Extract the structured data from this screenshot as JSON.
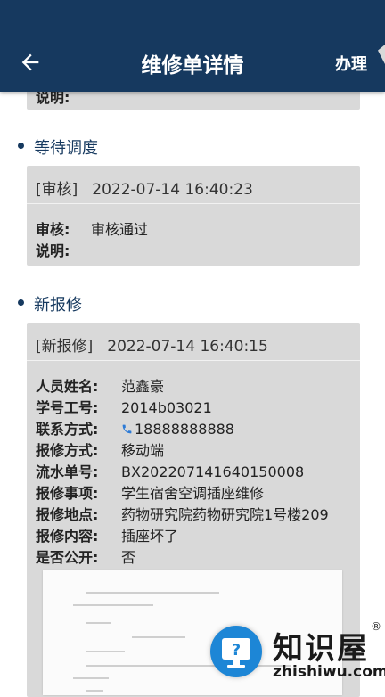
{
  "header": {
    "title": "维修单详情",
    "action_label": "办理"
  },
  "top_card": {
    "partial_label": "说明:"
  },
  "sections": [
    {
      "title": "等待调度",
      "tag": "[审核]",
      "time": "2022-07-14 16:40:23",
      "review_key": "审核:",
      "review_value": "审核通过",
      "note_key": "说明:"
    },
    {
      "title": "新报修",
      "tag": "[新报修]",
      "time": "2022-07-14 16:40:15",
      "fields": [
        {
          "k": "人员姓名:",
          "v": "范鑫豪"
        },
        {
          "k": "学号工号:",
          "v": "2014b03021"
        },
        {
          "k": "联系方式:",
          "v": "18888888888"
        },
        {
          "k": "报修方式:",
          "v": "移动端"
        },
        {
          "k": "流水单号:",
          "v": "BX202207141640150008"
        },
        {
          "k": "报修事项:",
          "v": "学生宿舍空调插座维修"
        },
        {
          "k": "报修地点:",
          "v": "药物研究院药物研究院1号楼209"
        },
        {
          "k": "报修内容:",
          "v": "插座坏了"
        },
        {
          "k": "是否公开:",
          "v": "否"
        }
      ]
    }
  ],
  "watermark": {
    "brand": "知识屋",
    "reg": "®",
    "url": "zhishiwu.com"
  },
  "colors": {
    "header_bg": "#16395f",
    "card_bg": "#d9d9d9",
    "approved": "#3aa85a",
    "link": "#2c7ad6"
  }
}
